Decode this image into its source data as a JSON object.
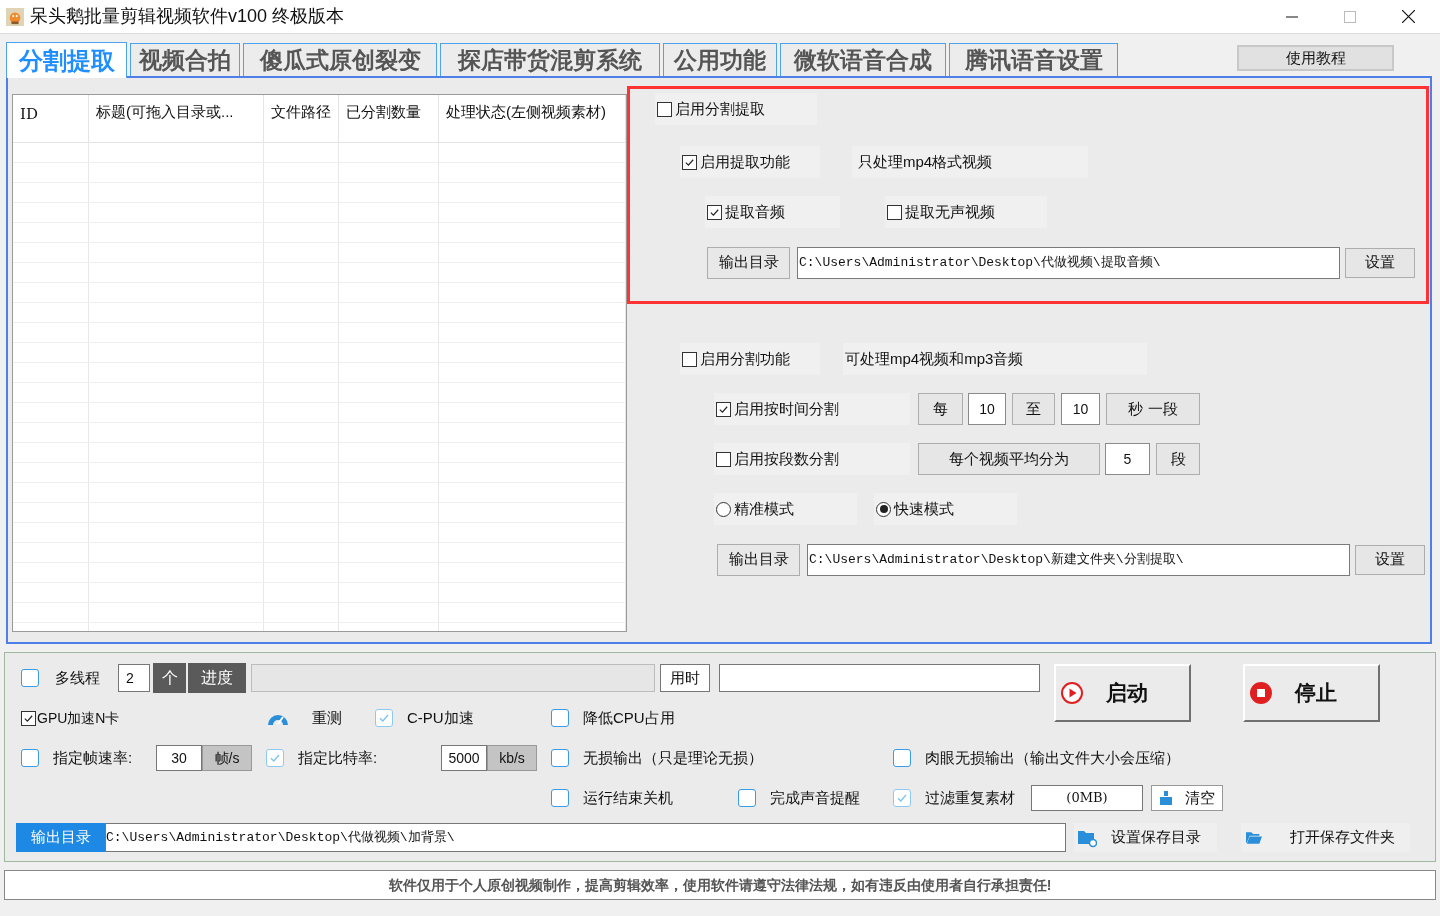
{
  "window": {
    "title": "呆头鹅批量剪辑视频软件v100 终极版本"
  },
  "tabs": [
    {
      "label": "分割提取",
      "selected": true
    },
    {
      "label": "视频合拍",
      "selected": false
    },
    {
      "label": "傻瓜式原创裂变",
      "selected": false
    },
    {
      "label": "探店带货混剪系统",
      "selected": false
    },
    {
      "label": "公用功能",
      "selected": false
    },
    {
      "label": "微软语音合成",
      "selected": false
    },
    {
      "label": "腾讯语音设置",
      "selected": false
    }
  ],
  "help_button": "使用教程",
  "table": {
    "columns": [
      "ID",
      "标题(可拖入目录或...",
      "文件路径",
      "已分割数量",
      "处理状态(左侧视频素材)"
    ]
  },
  "extract": {
    "enable": {
      "label": "启用分割提取",
      "checked": false
    },
    "feature": {
      "label": "启用提取功能",
      "checked": true
    },
    "feature_note": "只处理mp4格式视频",
    "options": [
      {
        "label": "提取音频",
        "checked": true
      },
      {
        "label": "提取无声视频",
        "checked": false
      }
    ],
    "output": {
      "button": "输出目录",
      "path": "C:\\Users\\Administrator\\Desktop\\代做视频\\提取音频\\",
      "set_button": "设置"
    }
  },
  "split": {
    "feature": {
      "label": "启用分割功能",
      "checked": false
    },
    "feature_note": "可处理mp4视频和mp3音频",
    "by_time": {
      "label": "启用按时间分割",
      "checked": true,
      "every": "每",
      "from": "10",
      "to": "至",
      "to_value": "10",
      "unit": "秒 一段"
    },
    "by_segments": {
      "label": "启用按段数分割",
      "checked": false,
      "text": "每个视频平均分为",
      "count": "5",
      "unit": "段"
    },
    "modes": [
      {
        "label": "精准模式",
        "selected": false
      },
      {
        "label": "快速模式",
        "selected": true
      }
    ],
    "output": {
      "button": "输出目录",
      "path": "C:\\Users\\Administrator\\Desktop\\新建文件夹\\分割提取\\",
      "set_button": "设置"
    }
  },
  "bottom": {
    "multithread": {
      "label": "多线程",
      "checked": false,
      "count": "2",
      "unit": "个"
    },
    "progress_label": "进度",
    "progress": {
      "level": 0
    },
    "elapsed_label": "用时",
    "start_button": "启动",
    "stop_button": "停止",
    "option_rows": [
      [
        {
          "kind": "classic_check",
          "label": "GPU加速N卡",
          "checked": true
        },
        {
          "kind": "button",
          "label": "重测"
        },
        {
          "kind": "check",
          "label": "C-PU加速",
          "checked": true
        },
        {
          "kind": "check",
          "label": "降低CPU占用",
          "checked": false
        }
      ],
      [
        {
          "kind": "check_field",
          "label": "指定帧速率:",
          "checked": false,
          "value": "30",
          "unit": "帧/s"
        },
        {
          "kind": "check_field",
          "label": "指定比特率:",
          "checked": true,
          "value": "5000",
          "unit": "kb/s"
        },
        {
          "kind": "check",
          "label": "无损输出（只是理论无损）",
          "checked": false
        },
        {
          "kind": "check",
          "label": "肉眼无损输出（输出文件大小会压缩）",
          "checked": false
        }
      ],
      [
        {
          "kind": "check",
          "label": "运行结束关机",
          "checked": false
        },
        {
          "kind": "check",
          "label": "完成声音提醒",
          "checked": false
        },
        {
          "kind": "check",
          "label": "过滤重复素材",
          "checked": true
        },
        {
          "kind": "field",
          "value": "(0MB)"
        },
        {
          "kind": "clear_button",
          "label": "清空"
        }
      ]
    ],
    "output": {
      "label": "输出目录",
      "path": "C:\\Users\\Administrator\\Desktop\\代做视频\\加背景\\",
      "set_button": "设置保存目录",
      "open_button": "打开保存文件夹"
    }
  },
  "notice": "软件仅用于个人原创视频制作，提高剪辑效率，使用软件请遵守法律法规，如有违反由使用者自行承担责任!"
}
